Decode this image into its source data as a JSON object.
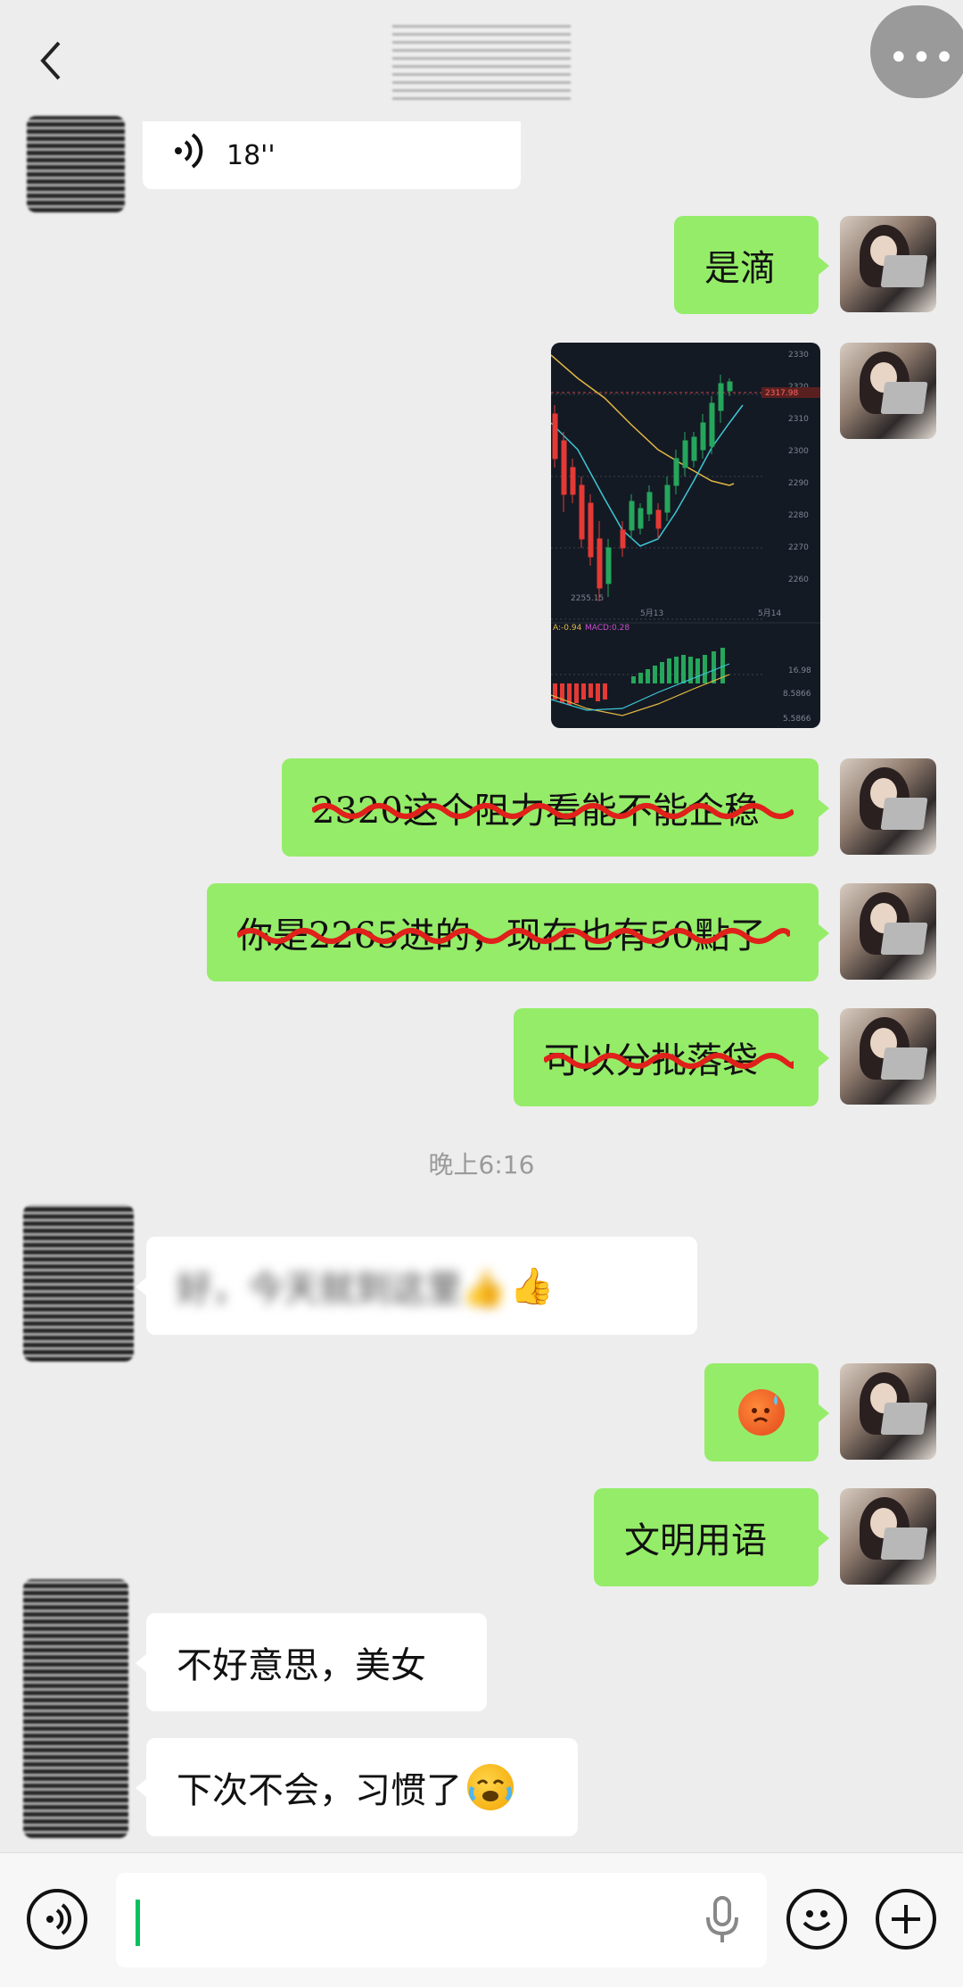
{
  "header": {
    "back_label": "<",
    "more_label": "•••"
  },
  "messages": {
    "voice": {
      "duration": "18''"
    },
    "m1": {
      "text": "是滴"
    },
    "m3": {
      "text": "2320这个阻力看能不能企稳"
    },
    "m4": {
      "text": "你是2265进的，现在也有50點了"
    },
    "m5": {
      "text": "可以分批落袋"
    },
    "time": "晚上6:16",
    "m6": {
      "text": "好，今天就到这里👍",
      "emoji": "👍"
    },
    "m8": {
      "text": "文明用语"
    },
    "m9": {
      "text": "不好意思，美女"
    },
    "m10": {
      "text": "下次不会，习惯了",
      "emoji": "😭"
    }
  },
  "chart_image": {
    "price_ticks": [
      "2330",
      "2320",
      "2310",
      "2300",
      "2290",
      "2280",
      "2270",
      "2260"
    ],
    "current_price": "2317.98",
    "low_label": "2255.15",
    "date_left": "5月13",
    "date_right": "5月14",
    "macd_label": "MACD:0.28",
    "dif_label": "A:-0.94",
    "macd_ticks": [
      "16.98",
      "8.5866",
      "5.5866"
    ]
  },
  "input": {
    "value": ""
  },
  "colors": {
    "bubble_me": "#95ec69",
    "bubble_other": "#ffffff",
    "background": "#ededed",
    "strike": "#e0201a"
  }
}
